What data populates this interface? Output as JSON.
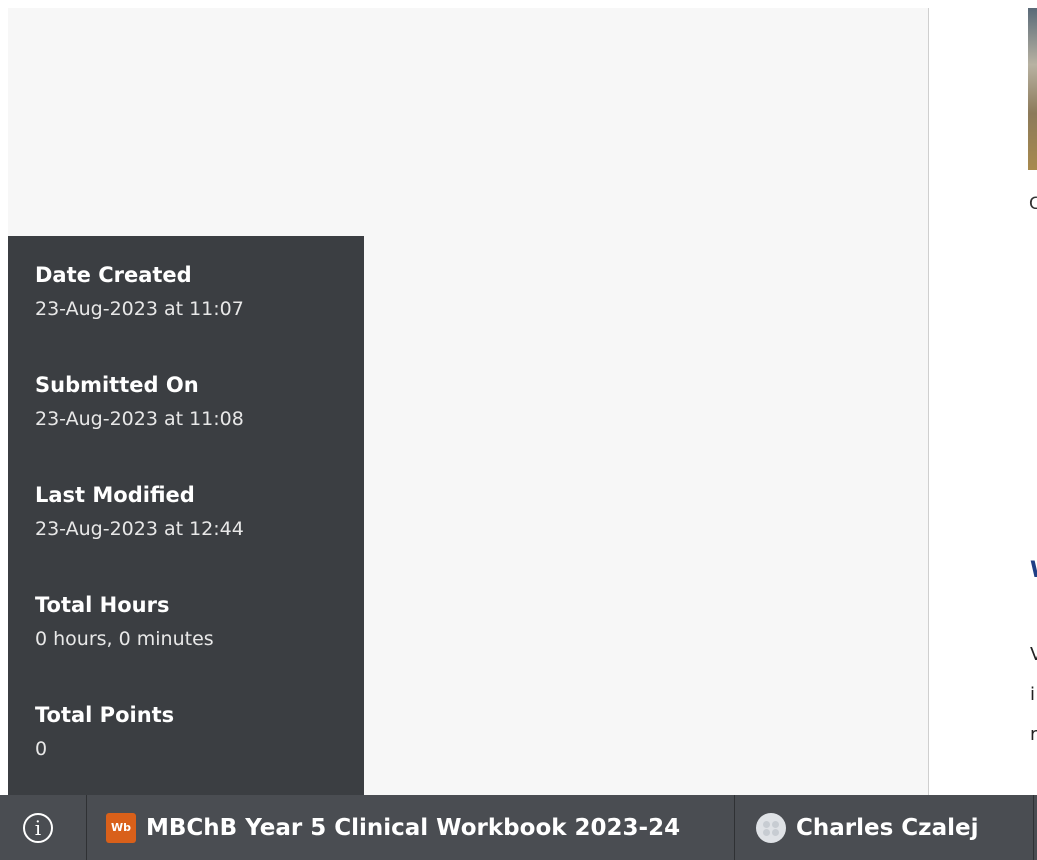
{
  "info_panel": {
    "items": [
      {
        "label": "Date Created",
        "value": "23-Aug-2023 at 11:07"
      },
      {
        "label": "Submitted On",
        "value": "23-Aug-2023 at 11:08"
      },
      {
        "label": "Last Modified",
        "value": "23-Aug-2023 at 12:44"
      },
      {
        "label": "Total Hours",
        "value": "0 hours, 0 minutes"
      },
      {
        "label": "Total Points",
        "value": "0"
      }
    ]
  },
  "right_panel": {
    "caption_fragment": "C",
    "heading_fragment": "W",
    "text_fragments": [
      "V",
      "i",
      "r"
    ]
  },
  "bottom_bar": {
    "info_icon": "info-icon",
    "info_glyph": "i",
    "workbook_logo_text": "Wb",
    "workbook_title": "MBChB Year 5 Clinical Workbook 2023-24",
    "user_name": "Charles Czalej",
    "colors": {
      "bar_background": "#4a4d52",
      "panel_background": "#3b3e42",
      "logo_orange": "#d9601a",
      "heading_blue": "#1f3f86"
    }
  }
}
